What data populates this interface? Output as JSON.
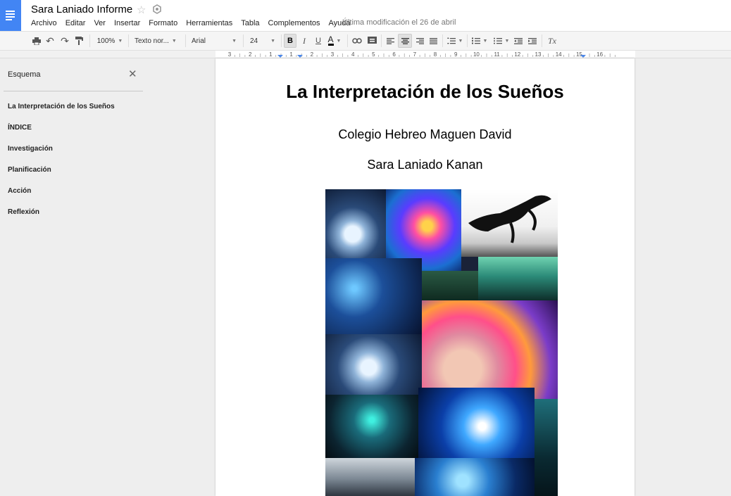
{
  "app": {
    "doc_title": "Sara Laniado Informe",
    "last_modified": "Última modificación el 26 de abril"
  },
  "menu": [
    "Archivo",
    "Editar",
    "Ver",
    "Insertar",
    "Formato",
    "Herramientas",
    "Tabla",
    "Complementos",
    "Ayuda"
  ],
  "toolbar": {
    "zoom": "100%",
    "style": "Texto nor...",
    "font": "Arial",
    "font_size": "24",
    "bold": "B",
    "italic": "I",
    "underline": "U",
    "text_color_letter": "A",
    "clear_format": "Tx"
  },
  "ruler": {
    "ticks": [
      "3",
      "2",
      "1",
      "1",
      "2",
      "3",
      "4",
      "5",
      "6",
      "7",
      "8",
      "9",
      "10",
      "11",
      "12",
      "13",
      "14",
      "15",
      "16"
    ]
  },
  "outline": {
    "title": "Esquema",
    "items": [
      "La Interpretación de los Sueños",
      "ÍNDICE",
      "Investigación",
      "Planificación",
      "Acción",
      "Reflexión"
    ]
  },
  "document": {
    "heading": "La Interpretación de los Sueños",
    "school": "Colegio Hebreo Maguen David",
    "author": "Sara Laniado Kanan"
  },
  "colors": {
    "docs_blue": "#4285f4",
    "sidebar_bg": "#eeeeee",
    "toolbar_bg": "#f5f5f5"
  }
}
